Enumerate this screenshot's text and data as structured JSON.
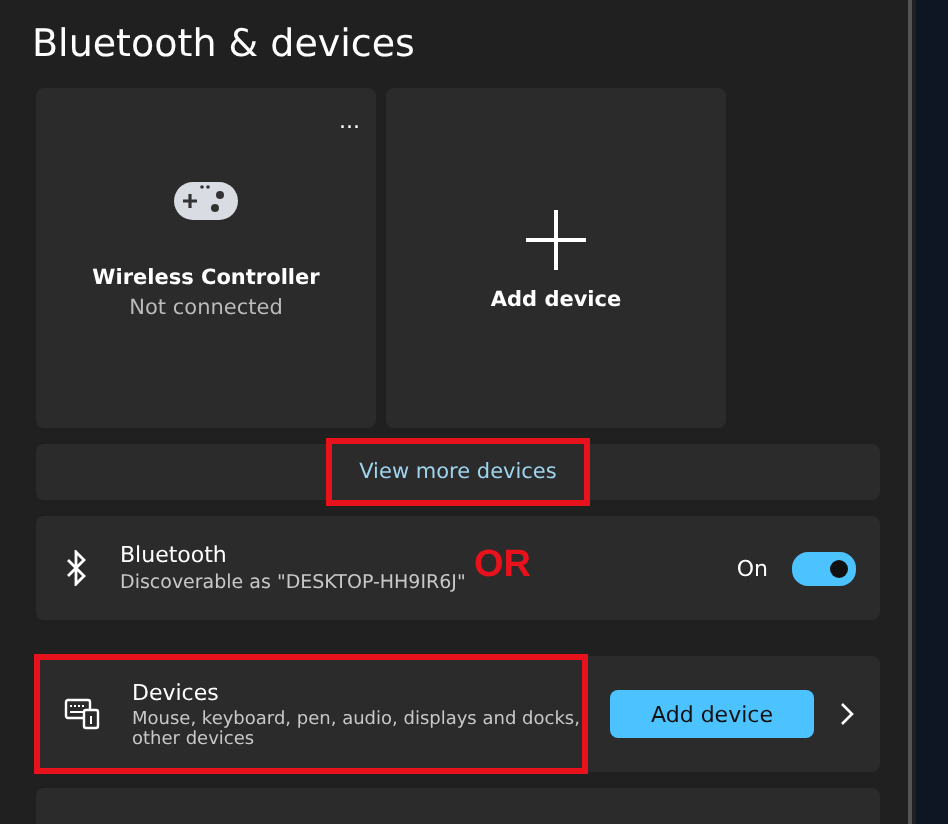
{
  "page_title": "Bluetooth & devices",
  "device_tiles": [
    {
      "kind": "device",
      "name": "Wireless Controller",
      "status": "Not connected",
      "more": "..."
    },
    {
      "kind": "add",
      "label": "Add device"
    }
  ],
  "view_more": {
    "label": "View more devices",
    "highlighted": true
  },
  "bluetooth": {
    "title": "Bluetooth",
    "subtitle": "Discoverable as \"DESKTOP-HH9IR6J\"",
    "state_label": "On",
    "on": true
  },
  "devices": {
    "title": "Devices",
    "subtitle": "Mouse, keyboard, pen, audio, displays and docks, other devices",
    "button": "Add device",
    "highlighted": true
  },
  "annotation_note": "OR"
}
